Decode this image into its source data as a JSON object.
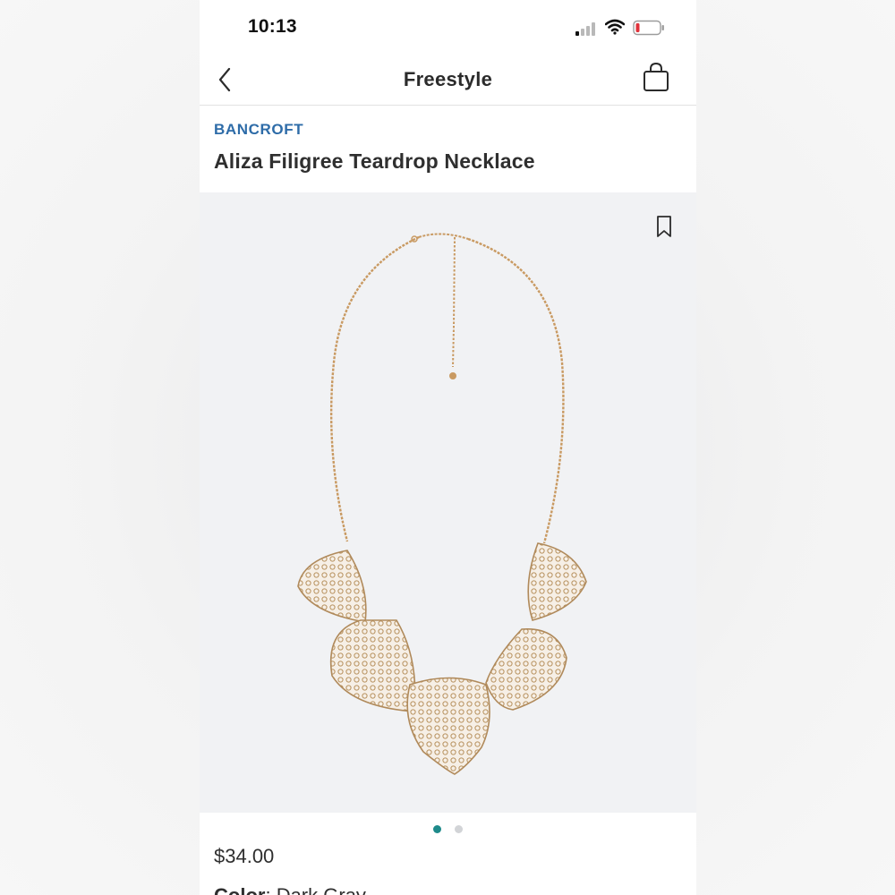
{
  "status_bar": {
    "time": "10:13"
  },
  "nav": {
    "title": "Freestyle",
    "back_icon": "chevron-left-icon",
    "bag_icon": "shopping-bag-icon"
  },
  "product": {
    "brand": "BANCROFT",
    "name": "Aliza Filigree Teardrop Necklace",
    "price": "$34.00",
    "color_label": "Color",
    "color_value": "Dark Gray"
  },
  "image_carousel": {
    "total_images": 2,
    "active_index": 0,
    "bookmark_icon": "bookmark-icon"
  },
  "colors": {
    "brand_blue": "#2e6ca8",
    "active_dot": "#1e8a8a",
    "inactive_dot": "#d2d4d7",
    "battery_low": "#e0333b"
  }
}
